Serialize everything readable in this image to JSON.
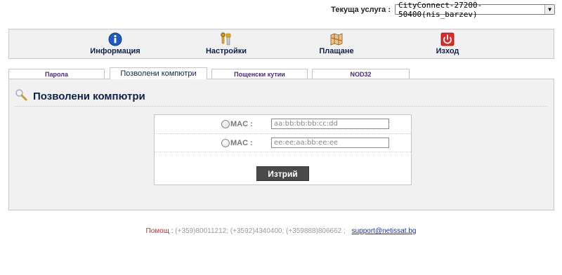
{
  "header": {
    "service_label": "Текуща услуга :",
    "service_value": "CityConnect-27200-50400(nis_barzev)"
  },
  "nav": [
    {
      "label": "Информация",
      "icon": "info-icon",
      "color": "#1e5bbf"
    },
    {
      "label": "Настройки",
      "icon": "tools-icon",
      "color": "#e3a92a"
    },
    {
      "label": "Плащане",
      "icon": "map-icon",
      "color": "#b5652d"
    },
    {
      "label": "Изход",
      "icon": "power-icon",
      "color": "#d92b2b"
    }
  ],
  "tabs": [
    {
      "label": "Парола"
    },
    {
      "label": "Позволени компютри",
      "active": true
    },
    {
      "label": "Пощенски кутии"
    },
    {
      "label": "NOD32"
    }
  ],
  "panel": {
    "title": "Позволени компютри",
    "rows": [
      {
        "label": "MAC :",
        "value": "aa:bb:bb:bb:cc:dd"
      },
      {
        "label": "MAC :",
        "value": "ee:ee:aa:bb:ee:ee"
      }
    ],
    "delete_label": "Изтрий"
  },
  "footer": {
    "help_label": "Помощ :",
    "phones": "(+359)80011212; (+3592)4340400; (+359888)806662 ;",
    "email": "support@netissat.bg"
  }
}
